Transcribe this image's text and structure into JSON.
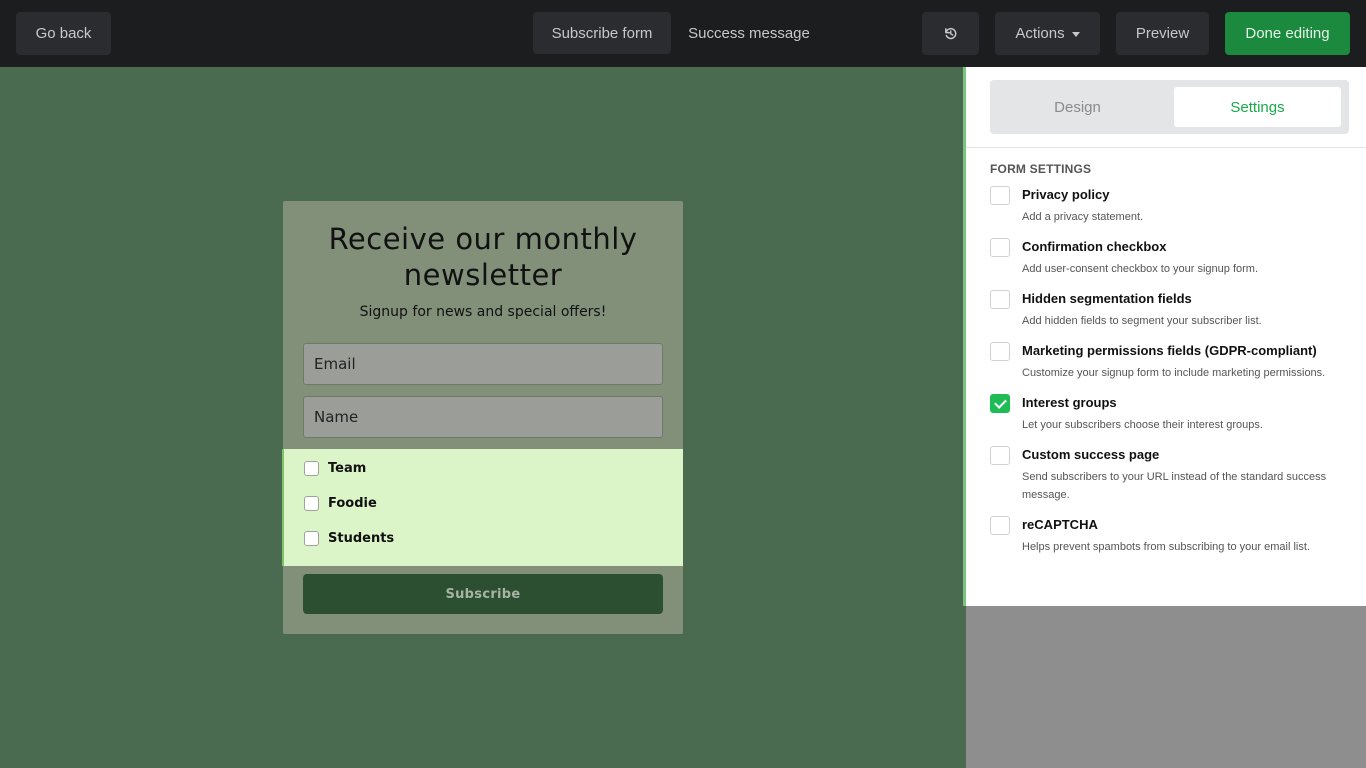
{
  "topbar": {
    "back_label": "Go back",
    "tab_subscribe_label": "Subscribe form",
    "tab_success_label": "Success message",
    "history_icon": "history-icon",
    "actions_label": "Actions",
    "preview_label": "Preview",
    "done_label": "Done editing"
  },
  "form": {
    "title": "Receive our monthly newsletter",
    "subtitle": "Signup for news and special offers!",
    "email_placeholder": "Email",
    "name_placeholder": "Name",
    "groups": [
      "Team",
      "Foodie",
      "Students"
    ],
    "subscribe_label": "Subscribe"
  },
  "panel": {
    "tabs": {
      "design": "Design",
      "settings": "Settings"
    },
    "section_title": "FORM SETTINGS",
    "options": [
      {
        "title": "Privacy policy",
        "desc": "Add a privacy statement.",
        "checked": false
      },
      {
        "title": "Confirmation checkbox",
        "desc": "Add user-consent checkbox to your signup form.",
        "checked": false
      },
      {
        "title": "Hidden segmentation fields",
        "desc": "Add hidden fields to segment your subscriber list.",
        "checked": false
      },
      {
        "title": "Marketing permissions fields (GDPR-compliant)",
        "desc": "Customize your signup form to include marketing permissions.",
        "checked": false
      },
      {
        "title": "Interest groups",
        "desc": "Let your subscribers choose their interest groups.",
        "checked": true
      },
      {
        "title": "Custom success page",
        "desc": "Send subscribers to your URL instead of the standard success message.",
        "checked": false
      },
      {
        "title": "reCAPTCHA",
        "desc": "Helps prevent spambots from subscribing to your email list.",
        "checked": false
      }
    ]
  },
  "colors": {
    "accent": "#19a84b",
    "canvas_bg": "#4a6b4f",
    "done_button": "#1b8a3f"
  }
}
